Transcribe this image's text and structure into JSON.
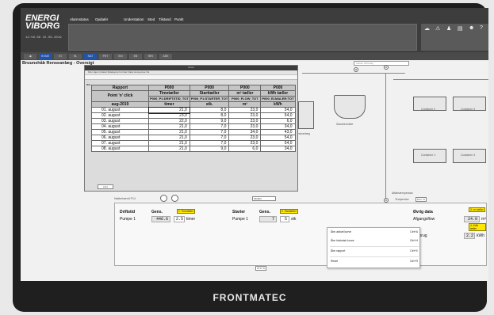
{
  "brand": "FRONTMATEC",
  "logo": {
    "line1": "ENERGI",
    "line2": "VIBORG"
  },
  "clock": "12:59:38 15.08.2019",
  "menu": [
    "Alarmstatus",
    "Opdatér",
    "Understation",
    "Sted",
    "Tilstand",
    "Punkt"
  ],
  "tabs": [
    "HOME",
    "KI",
    "HL",
    "NAT",
    "PST",
    "SKI",
    "EB",
    "BRI",
    "ASE"
  ],
  "page_title": "Bruunshåb Renseanlæg - Oversigt",
  "input_placeholder": "Indtast driftsvalg",
  "excel": {
    "window_title": "Excel",
    "ribbon": "Filer  Hjem  Indsæt  Sidelayout  Formler  Data  Gennemse  Vis",
    "cell_ref": "B31",
    "sheet_tab": "Ark1",
    "header": {
      "rapport": "Rapport",
      "point_click": "Point 'n' click",
      "period": "aug-2019",
      "cols": [
        {
          "code": "P000",
          "title": "Timetæller",
          "tag": "P000_P1:DRIFTSTID_TOT",
          "unit": "timer"
        },
        {
          "code": "P000",
          "title": "Starttæller",
          "tag": "P000_P1:STARTER_TOT",
          "unit": "stk."
        },
        {
          "code": "P000",
          "title": "m³ tæller",
          "tag": "P000_FLOW_TOT",
          "unit": "m³"
        },
        {
          "code": "P000",
          "title": "kWh tæller",
          "tag": "P000_ELMALER:TOT",
          "unit": "kWh"
        }
      ]
    },
    "rows": [
      [
        "01. august",
        "21,0",
        "8,0",
        "23,0",
        "54,0"
      ],
      [
        "02. august",
        "23,0",
        "8,0",
        "23,0",
        "54,0"
      ],
      [
        "03. august",
        "22,0",
        "9,0",
        "23,0",
        "6,0"
      ],
      [
        "04. august",
        "21,0",
        "7,0",
        "23,0",
        "34,0"
      ],
      [
        "05. august",
        "21,0",
        "7,0",
        "34,0",
        "43,0"
      ],
      [
        "06. august",
        "21,0",
        "7,0",
        "23,0",
        "54,0"
      ],
      [
        "07. august",
        "21,0",
        "7,0",
        "23,0",
        "54,0"
      ],
      [
        "08. august",
        "21,0",
        "9,0",
        "6,0",
        "34,0"
      ]
    ]
  },
  "schematic": {
    "renseanlaeg": "Renseanlæg",
    "slambeholder": "Slambeholder",
    "containers": [
      "Container 2",
      "Container 3",
      "Container 1",
      "Container 4"
    ],
    "flow_val": "29.4 m³",
    "aflaeb_label": "Afløbstemperatur",
    "temp_label": "Temperatur",
    "temp_val": "16.1 °C",
    "bottom_val": "37.8 °C"
  },
  "panel": {
    "small_title": "Nøkkelværdi P14",
    "driftstid": {
      "label": "Driftstid",
      "gens": "Gens.",
      "pumpe": "Pumpe 1",
      "value": "446.6",
      "unit": "timer",
      "flag": "1. Timetæller"
    },
    "starter": {
      "label": "Starter",
      "gens": "Gens.",
      "pumpe": "Pumpe 1",
      "value": "7",
      "unit": "stk",
      "flag": "2. Starttæller"
    },
    "ovrig": {
      "label": "Øvrig data",
      "afgang": "Afgangsflow",
      "value": "24.0",
      "unit": "m³",
      "forbrug": "Forbrug",
      "value2": "2.2",
      "unit2": "kWh",
      "flag1": "3. m³ tæller",
      "flag2": "4. kWh tæller"
    },
    "btn": "Modifer"
  },
  "context_menu": [
    {
      "label": "Åbn aktuel kurve",
      "key": "Ctrl+A"
    },
    {
      "label": "Åbn historisk kurve",
      "key": "Ctrl+H"
    },
    {
      "label": "Åbn rapport",
      "key": "Ctrl+X"
    },
    {
      "label": "Reset",
      "key": "Ctrl+R"
    }
  ]
}
